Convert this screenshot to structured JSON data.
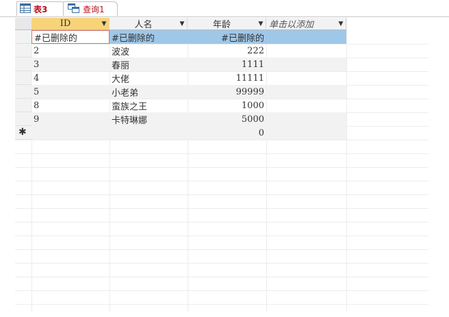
{
  "tabs": [
    {
      "label": "表3",
      "icon": "table-icon"
    },
    {
      "label": "查询1",
      "icon": "query-icon"
    }
  ],
  "columns": [
    {
      "label": "ID"
    },
    {
      "label": "人名"
    },
    {
      "label": "年龄"
    },
    {
      "label": "单击以添加"
    }
  ],
  "rows": [
    {
      "id": "#已删除的",
      "name": "#已删除的",
      "age": "#已删除的"
    },
    {
      "id": "2",
      "name": "波波",
      "age": "222"
    },
    {
      "id": "3",
      "name": "春丽",
      "age": "1111"
    },
    {
      "id": "4",
      "name": "大佬",
      "age": "11111"
    },
    {
      "id": "5",
      "name": "小老弟",
      "age": "99999"
    },
    {
      "id": "8",
      "name": "蛮族之王",
      "age": "1000"
    },
    {
      "id": "9",
      "name": "卡特琳娜",
      "age": "5000"
    }
  ],
  "new_row": {
    "marker": "✱",
    "age": "0"
  },
  "colors": {
    "active_header": "#f7d37a",
    "selected_row": "#9fc7e8",
    "tab_text": "#b4111e"
  }
}
